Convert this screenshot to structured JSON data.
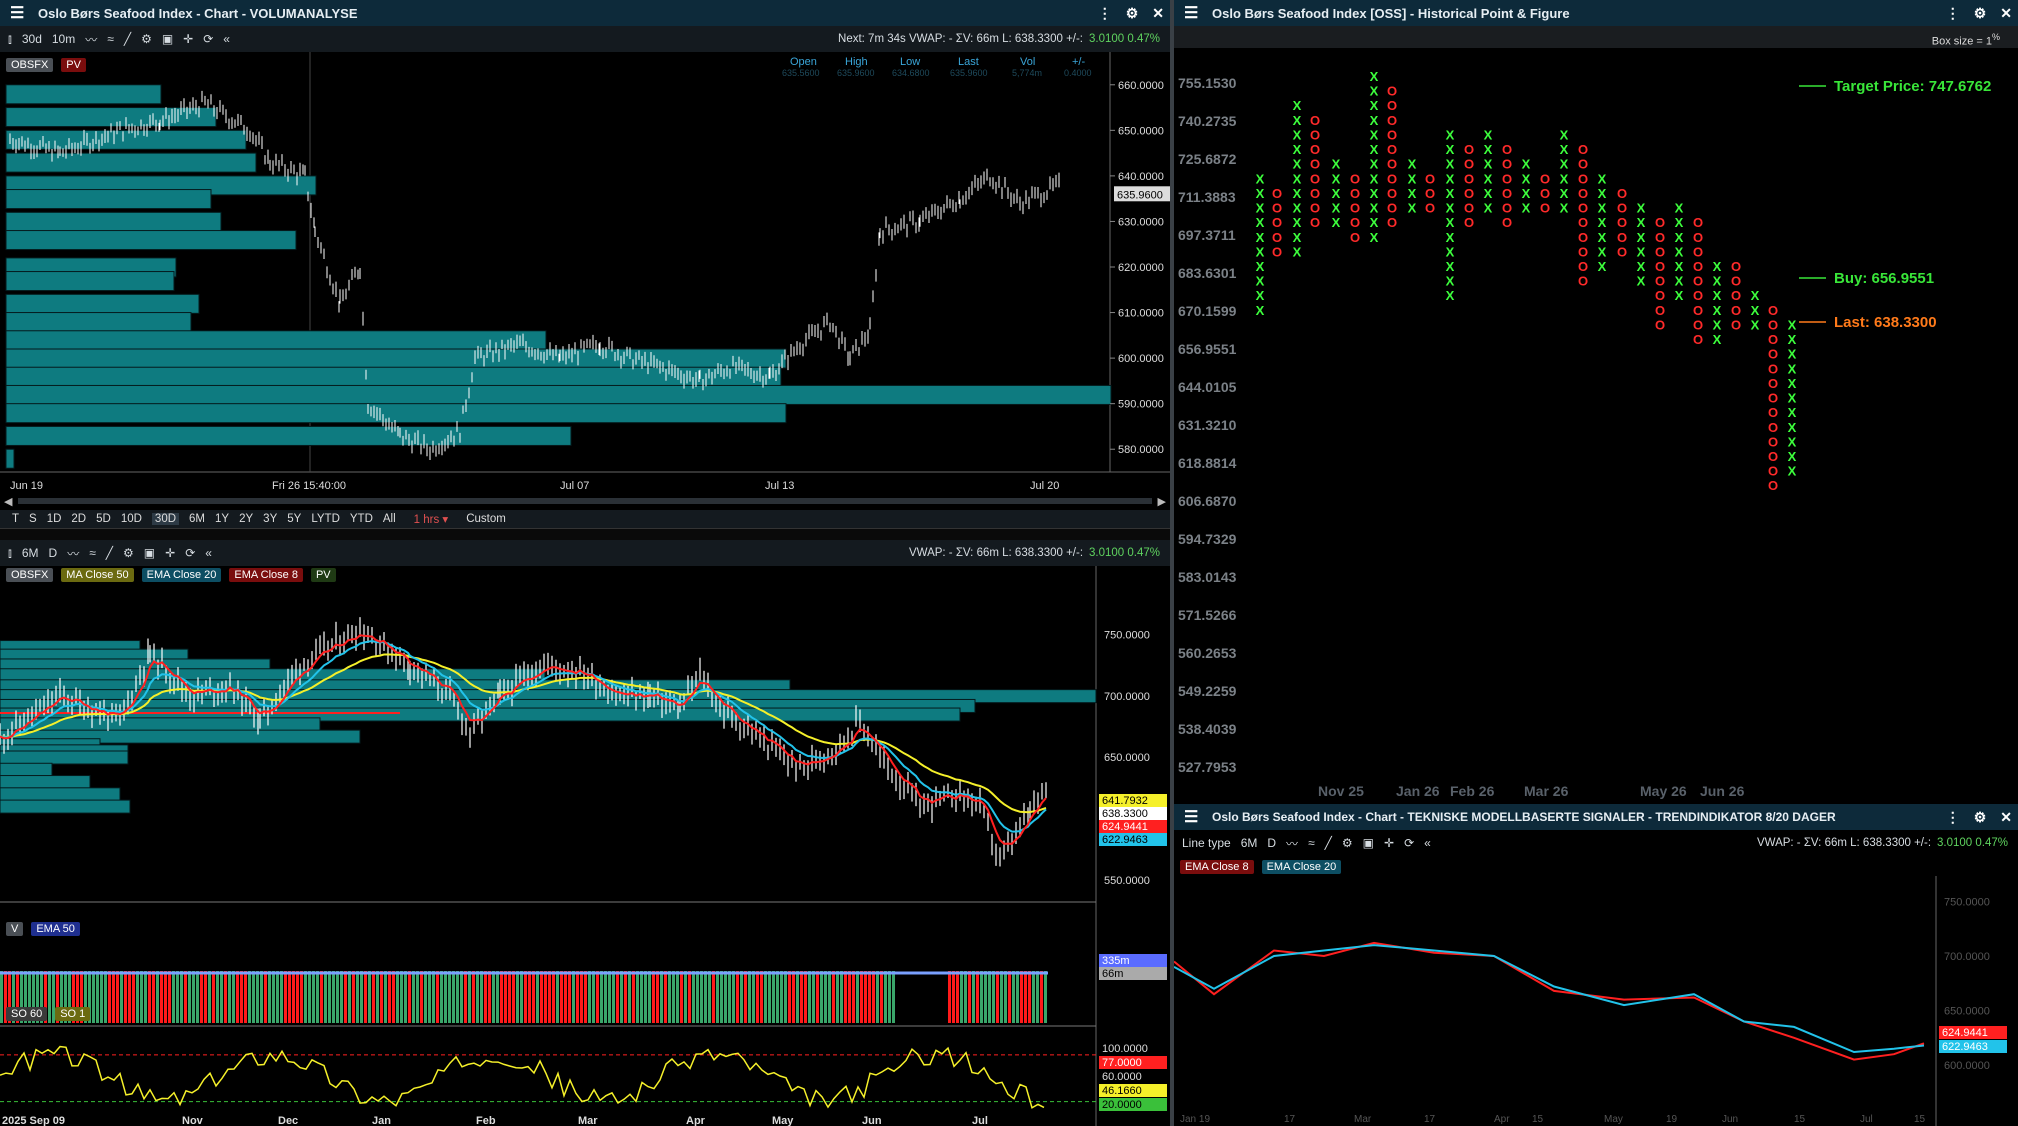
{
  "colors": {
    "title_bg": "#0d2a3a",
    "volume_profile": "#0e7b80",
    "up_x": "#3dff3d",
    "down_o": "#ff2a2a",
    "ema8": "#ff2020",
    "ema20": "#22c3ea",
    "ma50": "#f5f02a",
    "target_green": "#39e639",
    "last_orange": "#ff7a1a"
  },
  "top_left": {
    "title": "Oslo Børs Seafood Index - Chart - VOLUMANALYSE",
    "toolbar": {
      "period1": "30d",
      "period2": "10m"
    },
    "status": "Next: 7m 34s   VWAP: -   ΣV: 66m   L: 638.3300   +/-: ",
    "status_change": "3.0100  0.47%",
    "legend": [
      "OBSFX",
      "PV"
    ],
    "ohlc_headers": [
      "Open",
      "High",
      "Low",
      "Last",
      "Vol",
      "+/-"
    ],
    "ohlc_values": [
      "635.5600",
      "635.9600",
      "634.6800",
      "635.9600",
      "5,774m",
      "0.4000"
    ],
    "y_ticks": [
      "660.0000",
      "650.0000",
      "640.0000",
      "630.0000",
      "620.0000",
      "610.0000",
      "600.0000",
      "590.0000",
      "580.0000"
    ],
    "last_price_tag": "635.9600",
    "x_ticks": [
      "Jun 19",
      "Fri 26 15:40:00",
      "Jul 07",
      "Jul 13",
      "Jul 20"
    ],
    "range_buttons": [
      "T",
      "S",
      "1D",
      "2D",
      "5D",
      "10D",
      "30D",
      "6M",
      "1Y",
      "2Y",
      "3Y",
      "5Y",
      "LYTD",
      "YTD",
      "All"
    ],
    "interval_label": "1 hrs",
    "custom_label": "Custom"
  },
  "bottom_left": {
    "toolbar": {
      "period1": "6M",
      "period2": "D"
    },
    "status": "VWAP: -   ΣV: 66m   L: 638.3300   +/-: ",
    "status_change": "3.0100  0.47%",
    "legend": [
      "OBSFX",
      "MA Close 50",
      "EMA Close 20",
      "EMA Close 8",
      "PV"
    ],
    "y_ticks": [
      "750.0000",
      "700.0000",
      "650.0000",
      "600.0000",
      "550.0000"
    ],
    "price_tags": [
      "641.7932",
      "638.3300",
      "624.9441",
      "622.9463"
    ],
    "volume_legend": [
      "V",
      "EMA 50"
    ],
    "volume_tags": [
      "335m",
      "66m"
    ],
    "osc_legend": [
      "SO 60",
      "SO 1"
    ],
    "osc_ticks": [
      "100.0000",
      "77.0000",
      "60.0000",
      "46.1660",
      "20.0000"
    ],
    "x_ticks": [
      "2025 Sep 09",
      "Nov",
      "Dec",
      "Jan",
      "Feb",
      "Mar",
      "Apr",
      "May",
      "Jun",
      "Jul"
    ]
  },
  "top_right": {
    "title": "Oslo Børs Seafood Index [OSS] - Historical Point & Figure",
    "box_size_label": "Box size = 1",
    "box_size_sup": "%",
    "y_ticks": [
      "755.1530",
      "740.2735",
      "725.6872",
      "711.3883",
      "697.3711",
      "683.6301",
      "670.1599",
      "656.9551",
      "644.0105",
      "631.3210",
      "618.8814",
      "606.6870",
      "594.7329",
      "583.0143",
      "571.5266",
      "560.2653",
      "549.2259",
      "538.4039",
      "527.7953"
    ],
    "x_ticks": [
      "Nov 25",
      "Jan 26",
      "Feb 26",
      "Mar 26",
      "May 26",
      "Jun 26"
    ],
    "target_label": "Target Price: 747.6762",
    "buy_label": "Buy: 656.9551",
    "last_label": "Last: 638.3300"
  },
  "bottom_right": {
    "title": "Oslo Børs Seafood Index - Chart - TEKNISKE MODELLBASERTE SIGNALER - TRENDINDIKATOR 8/20 DAGER",
    "toolbar": {
      "line_type": "Line type",
      "period1": "6M",
      "period2": "D"
    },
    "status": "VWAP: -   ΣV: 66m   L: 638.3300   +/-: ",
    "status_change": "3.0100  0.47%",
    "legend": [
      "EMA Close 8",
      "EMA Close 20"
    ],
    "y_ticks": [
      "750.0000",
      "700.0000",
      "650.0000",
      "600.0000"
    ],
    "price_tags": [
      "624.9441",
      "622.9463"
    ],
    "x_ticks": [
      "Jan 19",
      "17",
      "Mar",
      "17",
      "Apr",
      "15",
      "May",
      "19",
      "Jun",
      "15",
      "Jul",
      "15"
    ]
  }
}
